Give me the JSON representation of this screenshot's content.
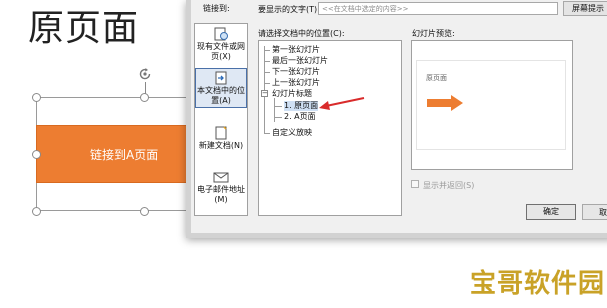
{
  "slide": {
    "title": "原页面",
    "button_text": "链接到A页面",
    "button_color": "#ed7d31"
  },
  "dialog": {
    "link_to_label": "链接到:",
    "text_to_display_label": "要显示的文字(T):",
    "text_to_display_value": "<<在文档中选定的内容>>",
    "screen_tip_button": "屏幕提示",
    "link_targets": [
      {
        "label": "现有文件或网页(X)",
        "icon": "existing-file-icon"
      },
      {
        "label": "本文档中的位置(A)",
        "icon": "place-in-document-icon",
        "selected": true
      },
      {
        "label": "新建文档(N)",
        "icon": "new-document-icon"
      },
      {
        "label": "电子邮件地址(M)",
        "icon": "email-address-icon"
      }
    ],
    "place_label": "请选择文档中的位置(C):",
    "tree_items": [
      {
        "label": "第一张幻灯片"
      },
      {
        "label": "最后一张幻灯片"
      },
      {
        "label": "下一张幻灯片"
      },
      {
        "label": "上一张幻灯片"
      },
      {
        "label": "幻灯片标题",
        "expander": "−"
      },
      {
        "label": "1. 原页面",
        "selected": true
      },
      {
        "label": "2. A页面"
      },
      {
        "label": "自定义放映"
      }
    ],
    "preview_label": "幻灯片预览:",
    "preview_slide_title": "原页面",
    "show_and_return_label": "显示并返回(S)",
    "ok_button": "确定",
    "cancel_button": "取消"
  },
  "annotation_arrow_color": "#d92b2b",
  "watermark_text": "宝哥软件园"
}
